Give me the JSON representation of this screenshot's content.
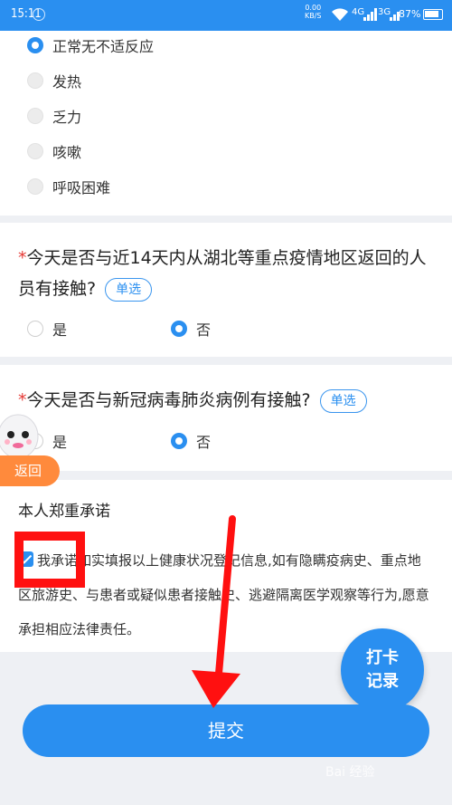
{
  "status_bar": {
    "time": "15:11",
    "speed": "0.00",
    "speed_unit": "KB/S",
    "net1": "4G",
    "net2": "3G",
    "battery": "87%"
  },
  "symptoms": {
    "options": [
      {
        "label": "正常无不适反应",
        "selected": true
      },
      {
        "label": "发热",
        "selected": false
      },
      {
        "label": "乏力",
        "selected": false
      },
      {
        "label": "咳嗽",
        "selected": false
      },
      {
        "label": "呼吸困难",
        "selected": false
      }
    ]
  },
  "q_hubei": {
    "required": "*",
    "text": "今天是否与近14天内从湖北等重点疫情地区返回的人员有接触?",
    "type_tag": "单选",
    "options": [
      {
        "label": "是",
        "selected": false
      },
      {
        "label": "否",
        "selected": true
      }
    ]
  },
  "q_covid": {
    "required": "*",
    "text": "今天是否与新冠病毒肺炎病例有接触?",
    "type_tag": "单选",
    "options": [
      {
        "label": "是",
        "selected": false
      },
      {
        "label": "否",
        "selected": true
      }
    ]
  },
  "back_button": {
    "label": "返回"
  },
  "pledge": {
    "title": "本人郑重承诺",
    "checked": true,
    "text": "我承诺如实填报以上健康状况登记信息,如有隐瞒疫病史、重点地区旅游史、与患者或疑似患者接触史、逃避隔离医学观察等行为,愿意承担相应法律责任。"
  },
  "punch_record": {
    "line1": "打卡",
    "line2": "记录"
  },
  "submit": {
    "label": "提交"
  },
  "watermark": {
    "text": "Bai 经验"
  },
  "colors": {
    "primary": "#2a8ff0",
    "required": "#e53935",
    "annotation": "#ff1010",
    "back": "#ff8a3c"
  }
}
